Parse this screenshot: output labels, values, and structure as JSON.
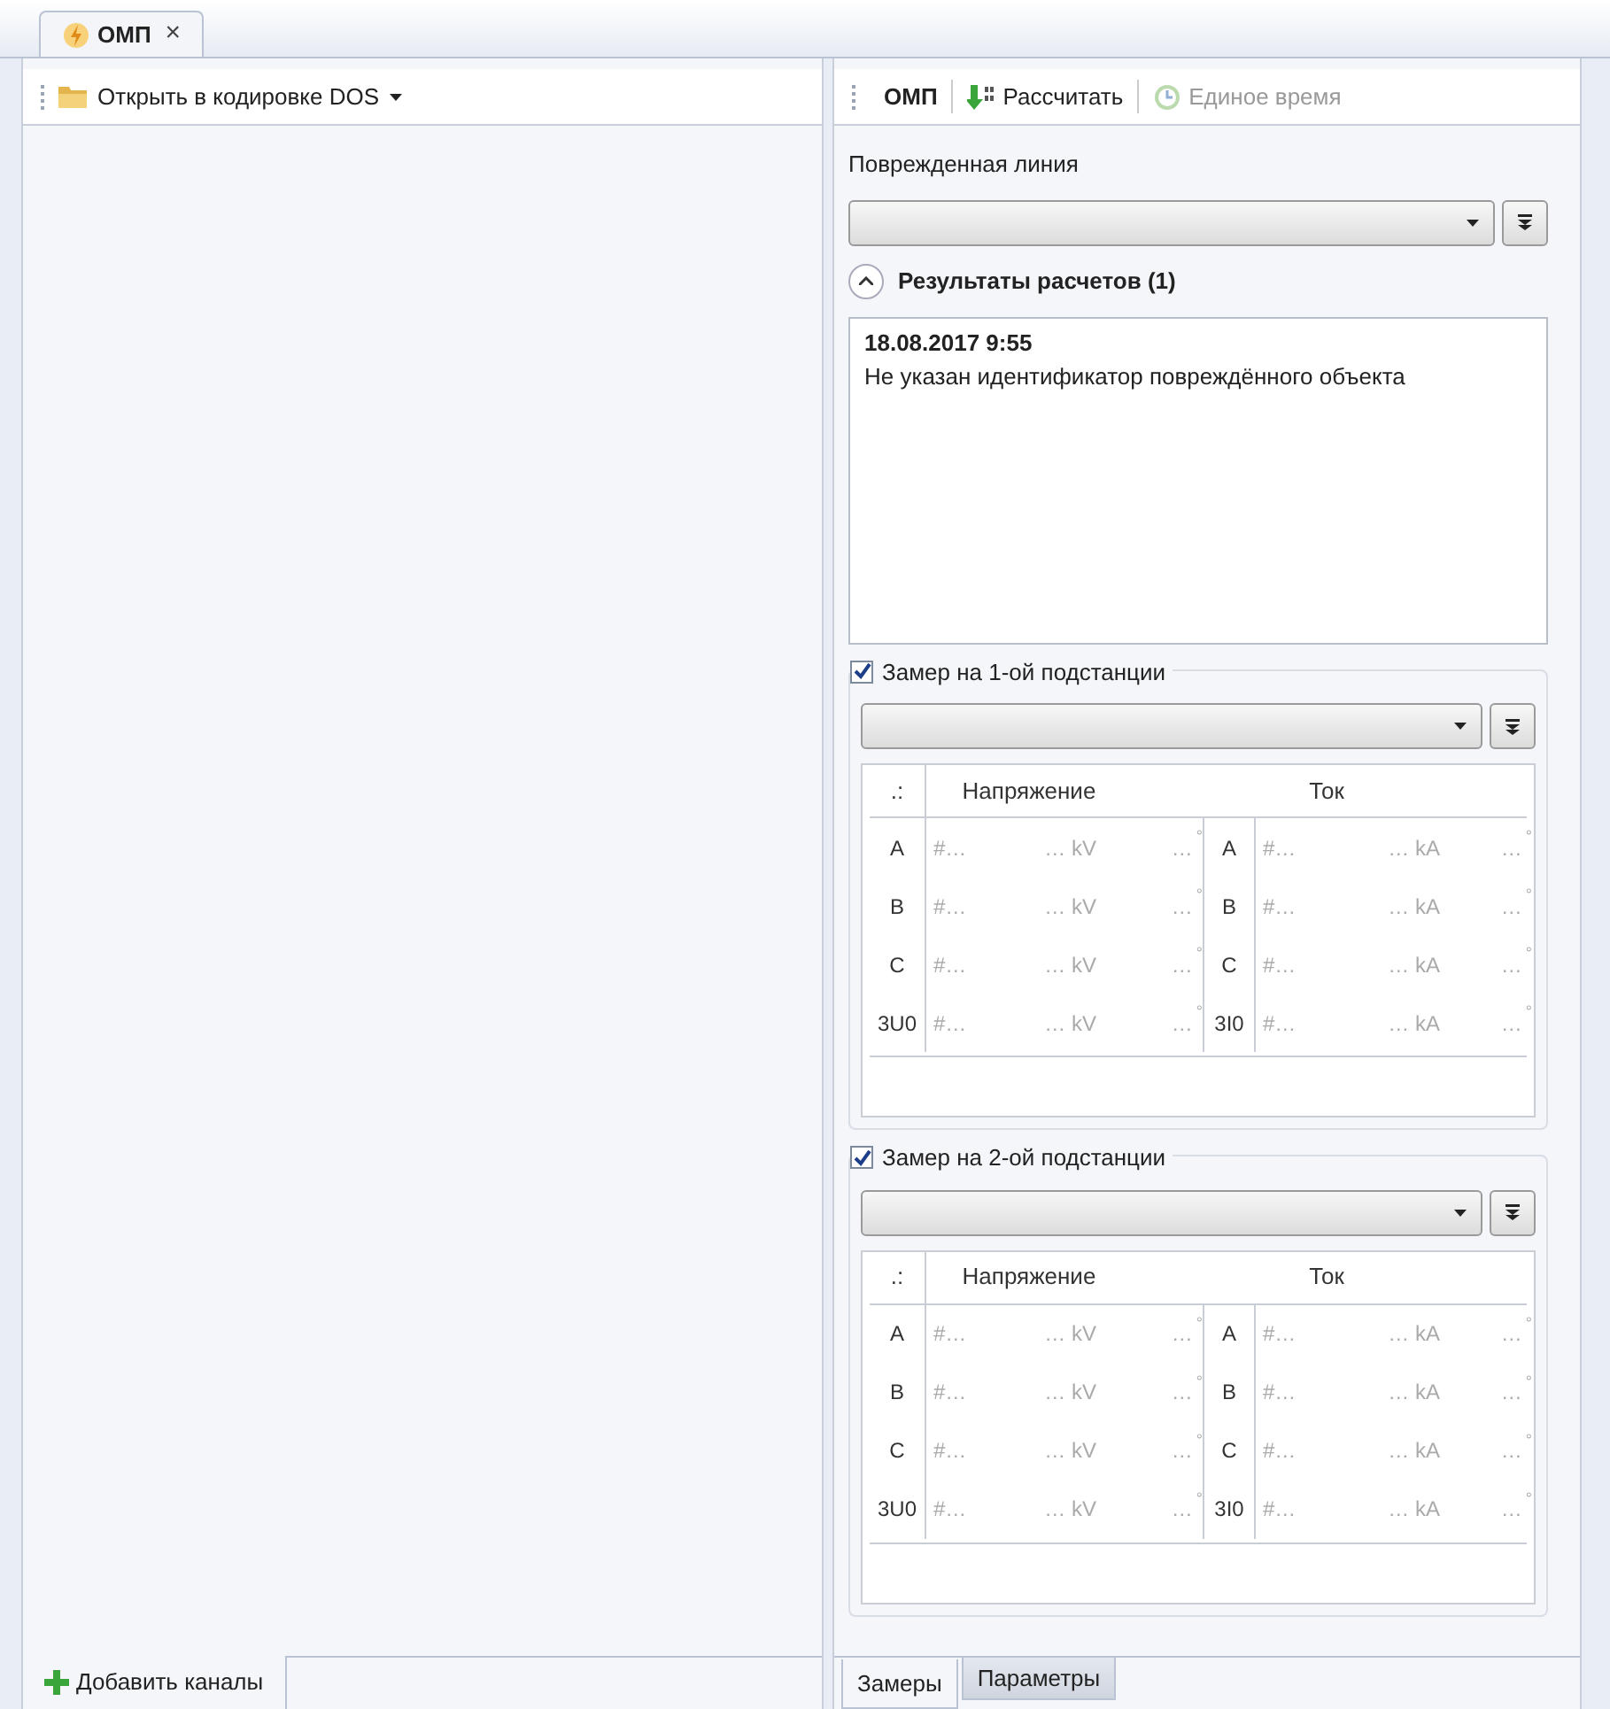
{
  "document_tab": {
    "title": "ОМП",
    "close": "×"
  },
  "left_panel": {
    "open_button": "Открыть в кодировке DOS",
    "add_button": "Добавить каналы"
  },
  "right_panel": {
    "toolbar": {
      "title": "ОМП",
      "buttons": [
        {
          "label": "Рассчитать",
          "disabled": false
        },
        {
          "label": "Единое время",
          "disabled": true
        }
      ]
    },
    "damaged_line": {
      "label": "Поврежденная линия"
    },
    "results": {
      "title": "Результаты расчетов (1)",
      "expanded": true,
      "entries": [
        {
          "time": "18.08.2017 9:55",
          "message": "Не указан идентификатор повреждённого объекта"
        }
      ]
    },
    "measurements": [
      {
        "title": "Замер на 1-ой подстанции",
        "checked": true,
        "corner": ".:",
        "voltage_header": "Напряжение",
        "current_header": "Ток",
        "rows": [
          {
            "phase_u": "A",
            "id_u": "#…",
            "value_u": "… kV",
            "angle_u": "…",
            "deg_u": "°",
            "phase_i": "A",
            "id_i": "#…",
            "value_i": "… kA",
            "angle_i": "…",
            "deg_i": "°"
          },
          {
            "phase_u": "B",
            "id_u": "#…",
            "value_u": "… kV",
            "angle_u": "…",
            "deg_u": "°",
            "phase_i": "B",
            "id_i": "#…",
            "value_i": "… kA",
            "angle_i": "…",
            "deg_i": "°"
          },
          {
            "phase_u": "C",
            "id_u": "#…",
            "value_u": "… kV",
            "angle_u": "…",
            "deg_u": "°",
            "phase_i": "C",
            "id_i": "#…",
            "value_i": "… kA",
            "angle_i": "…",
            "deg_i": "°"
          },
          {
            "phase_u": "3U0",
            "id_u": "#…",
            "value_u": "… kV",
            "angle_u": "…",
            "deg_u": "°",
            "phase_i": "3I0",
            "id_i": "#…",
            "value_i": "… kA",
            "angle_i": "…",
            "deg_i": "°"
          }
        ]
      },
      {
        "title": "Замер на 2-ой подстанции",
        "checked": true,
        "corner": ".:",
        "voltage_header": "Напряжение",
        "current_header": "Ток",
        "rows": [
          {
            "phase_u": "A",
            "id_u": "#…",
            "value_u": "… kV",
            "angle_u": "…",
            "deg_u": "°",
            "phase_i": "A",
            "id_i": "#…",
            "value_i": "… kA",
            "angle_i": "…",
            "deg_i": "°"
          },
          {
            "phase_u": "B",
            "id_u": "#…",
            "value_u": "… kV",
            "angle_u": "…",
            "deg_u": "°",
            "phase_i": "B",
            "id_i": "#…",
            "value_i": "… kA",
            "angle_i": "…",
            "deg_i": "°"
          },
          {
            "phase_u": "C",
            "id_u": "#…",
            "value_u": "… kV",
            "angle_u": "…",
            "deg_u": "°",
            "phase_i": "C",
            "id_i": "#…",
            "value_i": "… kA",
            "angle_i": "…",
            "deg_i": "°"
          },
          {
            "phase_u": "3U0",
            "id_u": "#…",
            "value_u": "… kV",
            "angle_u": "…",
            "deg_u": "°",
            "phase_i": "3I0",
            "id_i": "#…",
            "value_i": "… kA",
            "angle_i": "…",
            "deg_i": "°"
          }
        ]
      }
    ]
  },
  "bottom_tabs": [
    {
      "label": "Замеры",
      "selected": true
    },
    {
      "label": "Параметры",
      "selected": false
    }
  ]
}
